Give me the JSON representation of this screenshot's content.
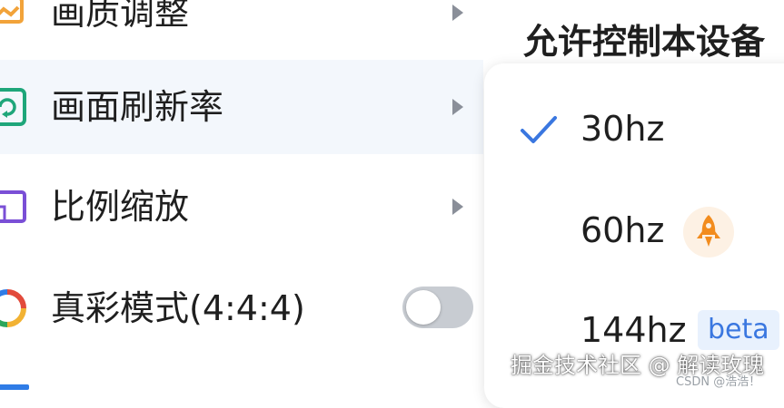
{
  "menu": {
    "items": [
      {
        "label": "画质调整"
      },
      {
        "label": "画面刷新率"
      },
      {
        "label": "比例缩放"
      },
      {
        "label": "真彩模式(4:4:4)"
      }
    ],
    "true_color_toggle": {
      "on": false
    }
  },
  "right_panel": {
    "title": "允许控制本设备"
  },
  "submenu": {
    "options": [
      {
        "label": "30hz",
        "selected": true
      },
      {
        "label": "60hz",
        "selected": false
      },
      {
        "label": "144hz",
        "selected": false,
        "badge": "beta"
      }
    ]
  },
  "watermark": {
    "main": "掘金技术社区 @ 解读玫瑰",
    "small": "CSDN @浩浩！"
  },
  "colors": {
    "check": "#3a77e0",
    "rocket": "#f28c1e",
    "beta_text": "#3a77e0",
    "beta_bg": "#e8f1fd",
    "active_row": "#f3f7fc"
  }
}
